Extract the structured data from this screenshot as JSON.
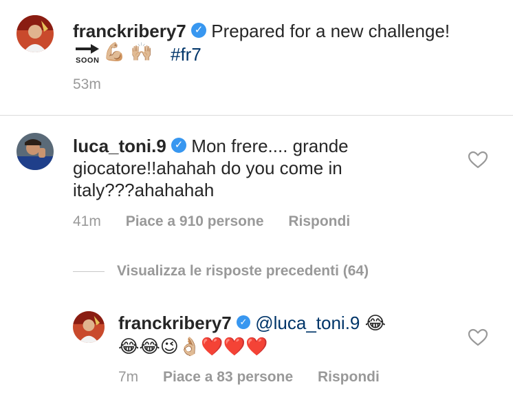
{
  "post": {
    "username": "franckribery7",
    "caption": "Prepared for a new challenge!",
    "soon_label": "SOON",
    "emojis": "💪🏼 🙌🏼",
    "hashtag": "#fr7",
    "time": "53m"
  },
  "comments": [
    {
      "username": "luca_toni.9",
      "text_line1": "Mon frere.... grande",
      "text_line2": "giocatore!!ahahah do you come in",
      "text_line3": "italy???ahahahah",
      "time": "41m",
      "likes": "Piace a 910 persone",
      "reply": "Rispondi"
    }
  ],
  "view_replies": "Visualizza le risposte precedenti (64)",
  "reply": {
    "username": "franckribery7",
    "mention": "@luca_toni.9",
    "emoji_line1": "😂",
    "emoji_line2": "😂😂😉👌🏼❤️❤️❤️",
    "time": "7m",
    "likes": "Piace a 83 persone",
    "reply": "Rispondi"
  },
  "colors": {
    "verified": "#3897f0",
    "link": "#003569",
    "meta": "#999999",
    "divider": "#dbdbdb"
  }
}
